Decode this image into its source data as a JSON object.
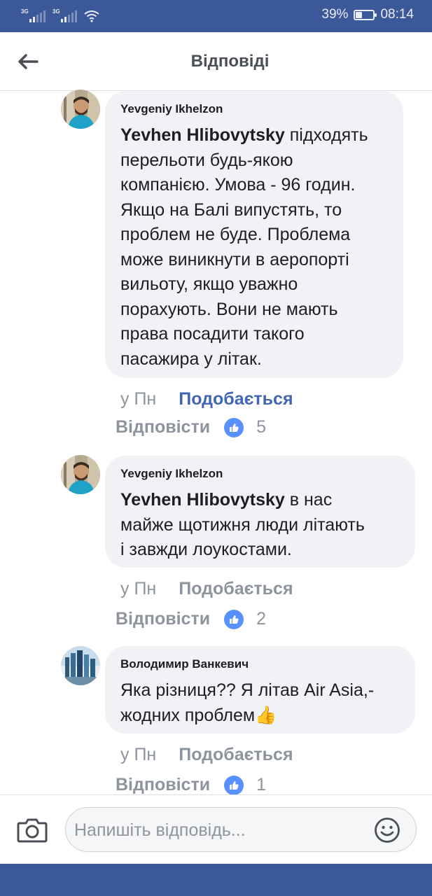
{
  "status_bar": {
    "network1": "3G",
    "network2": "3G",
    "battery_percent": "39%",
    "battery_level": 0.39,
    "time": "08:14"
  },
  "header": {
    "title": "Відповіді",
    "back_icon": "arrow-left-icon"
  },
  "comments": [
    {
      "author": "Yevgeniy Ikhelzon",
      "mention": "Yevhen Hlibovytsky",
      "lines": [
        " підходять",
        "перельоти будь-якою",
        "компанією. Умова - 96 годин.",
        "Якщо на Балі випустять, то",
        "проблем не буде. Проблема",
        "може виникнути в аеропорті",
        "вильоту, якщо уважно",
        "порахують. Вони не мають",
        "права посадити такого",
        "пасажира у літак."
      ],
      "time": "у Пн",
      "like_label": "Подобається",
      "like_active": true,
      "reply_label": "Відповісти",
      "like_count": "5"
    },
    {
      "author": "Yevgeniy Ikhelzon",
      "mention": "Yevhen Hlibovytsky",
      "lines": [
        " в нас",
        "майже щотижня люди літають",
        "і завжди лоукостами."
      ],
      "time": "у Пн",
      "like_label": "Подобається",
      "like_active": false,
      "reply_label": "Відповісти",
      "like_count": "2"
    },
    {
      "author": "Володимир Ванкевич",
      "mention": "",
      "lines": [
        "Яка різниця?? Я літав Air Asia,-",
        "жодних проблем👍"
      ],
      "time": "у Пн",
      "like_label": "Подобається",
      "like_active": false,
      "reply_label": "Відповісти",
      "like_count": "1"
    }
  ],
  "composer": {
    "placeholder": "Напишіть відповідь...",
    "camera_icon": "camera-icon",
    "emoji_icon": "smiley-icon"
  },
  "colors": {
    "brand": "#3b5998",
    "link_active": "#4267b2",
    "like_badge": "#5890ff",
    "bubble": "#f0f2f5",
    "muted": "#8d949e"
  }
}
